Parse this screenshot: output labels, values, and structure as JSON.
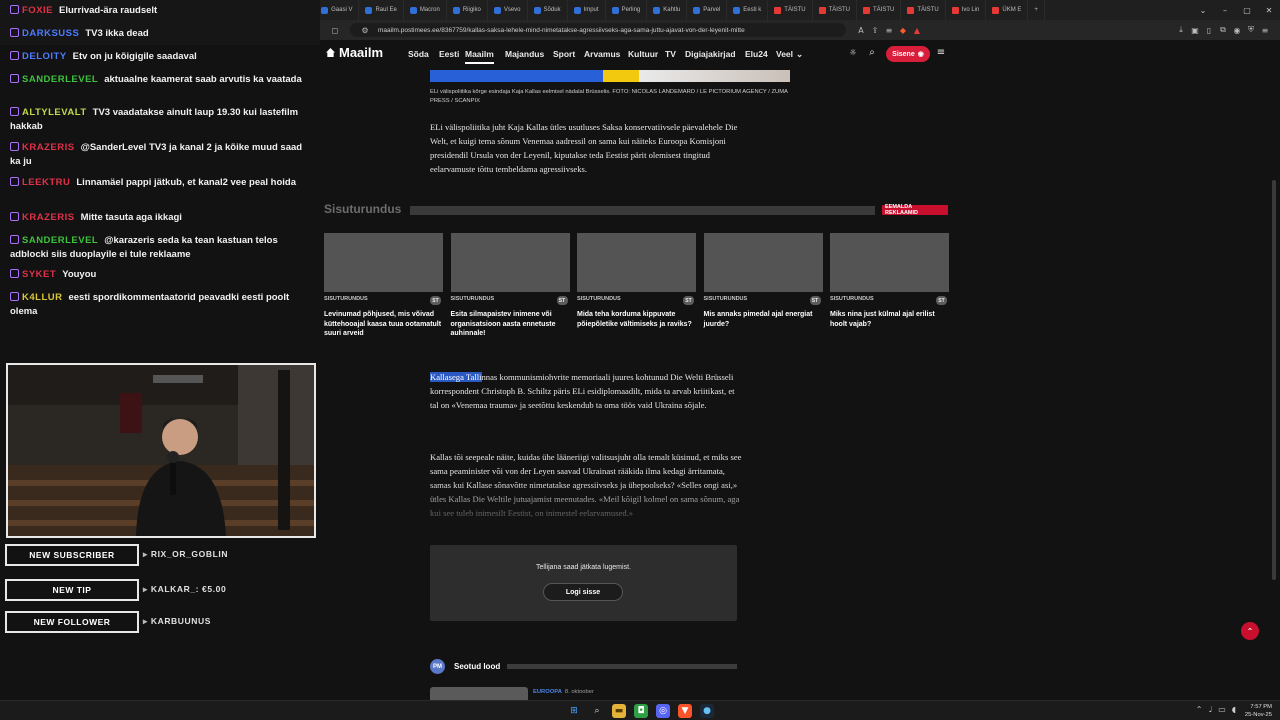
{
  "browser": {
    "tabs": [
      {
        "label": "Kal",
        "type": "normal",
        "active": true
      },
      {
        "label": "FOXIE",
        "type": "yt"
      },
      {
        "label": "Elurrivad-ära raudselt",
        "type": "normal"
      },
      {
        "label": "Sotsiaa",
        "type": "normal"
      },
      {
        "label": "Kohus",
        "type": "normal"
      },
      {
        "label": "Europ",
        "type": "normal"
      },
      {
        "label": "Tallinn",
        "type": "normal"
      },
      {
        "label": "Gaasi V",
        "type": "normal"
      },
      {
        "label": "Raul Ee",
        "type": "normal"
      },
      {
        "label": "Macron",
        "type": "normal"
      },
      {
        "label": "Riigiko",
        "type": "normal"
      },
      {
        "label": "Vsevo",
        "type": "normal"
      },
      {
        "label": "Sõduk",
        "type": "normal"
      },
      {
        "label": "Imput",
        "type": "normal"
      },
      {
        "label": "Perling",
        "type": "normal"
      },
      {
        "label": "Kahtlu",
        "type": "normal"
      },
      {
        "label": "Parvel",
        "type": "normal"
      },
      {
        "label": "Eesti k",
        "type": "normal"
      },
      {
        "label": "TÄISTU",
        "type": "yt"
      },
      {
        "label": "TÄISTU",
        "type": "yt"
      },
      {
        "label": "TÄISTU",
        "type": "yt"
      },
      {
        "label": "TÄISTU",
        "type": "yt"
      },
      {
        "label": "Ivo Lin",
        "type": "yt"
      },
      {
        "label": "ÜKM E",
        "type": "yt"
      }
    ],
    "new_tab": "+",
    "url": "maailm.postimees.ee/8367759/kallas-saksa-lehele-mind-nimetatakse-agressiivseks-aga-sama-juttu-ajavat-von-der-leyenit-mitte"
  },
  "chat": {
    "top_partial": {
      "user": "FOXIE",
      "text": "Elurrivad-ära raudselt"
    },
    "messages": [
      {
        "user": "DARKSUSS",
        "color": "#4c7cff",
        "text": "TV3 ikka dead"
      },
      {
        "user": "DELOITY",
        "color": "#4c7cff",
        "text": "Etv on ju kõigigile saadaval"
      },
      {
        "user": "SANDERLEVEL",
        "color": "#3ec23e",
        "text": "aktuaalne kaamerat saab arvutis ka vaatada"
      },
      {
        "user": "ALTYLEVALT",
        "color": "#c4d94a",
        "text": "TV3 vaadatakse ainult laup 19.30 kui lastefilm hakkab"
      },
      {
        "user": "KRAZERIS",
        "color": "#e0314a",
        "text": "@SanderLevel TV3 ja kanal 2 ja kõike muud saad ka ju"
      },
      {
        "user": "LEEKTRU",
        "color": "#e0314a",
        "text": "Linnamäel pappi jätkub, et kanal2 vee peal hoida"
      },
      {
        "user": "KRAZERIS",
        "color": "#e0314a",
        "text": "Mitte tasuta aga ikkagi"
      },
      {
        "user": "SANDERLEVEL",
        "color": "#3ec23e",
        "text": "@karazeris seda ka tean kastuan telos adblocki siis duoplayile ei tule reklaame"
      },
      {
        "user": "SYKET",
        "color": "#e0314a",
        "text": "Youyou"
      },
      {
        "user": "K4LLUR",
        "color": "#d9c63a",
        "text": "eesti spordikommentaatorid peavadki eesti poolt olema"
      }
    ]
  },
  "alerts": [
    {
      "label": "NEW SUBSCRIBER",
      "value": "RIX_OR_GOBLIN"
    },
    {
      "label": "NEW TIP",
      "value": "KALKAR_: €5.00"
    },
    {
      "label": "NEW FOLLOWER",
      "value": "KARBUUNUS"
    }
  ],
  "site": {
    "logo": "Maailm",
    "nav": [
      "Sõda",
      "Eesti",
      "Maailm",
      "Majandus",
      "Sport",
      "Arvamus",
      "Kultuur",
      "TV",
      "Digiajakirjad",
      "Elu24",
      "Veel"
    ],
    "active_nav": "Maailm",
    "login_label": "Sisene"
  },
  "article": {
    "caption": "ELi välispoliitika kõrge esindaja Kaja Kallas eelmisel nädalal Brüsselis. FOTO: NICOLAS LANDEMARD / LE PICTORIUM AGENCY / ZUMA PRESS / SCANPIX",
    "para1": "ELi välispoliitika juht Kaja Kallas ütles usutluses Saksa konservatiivsele päevalehele Die Welt, et kuigi tema sõnum Venemaa aadressil on sama kui näiteks Euroopa Komisjoni presidendil Ursula von der Leyenil, kiputakse teda Eestist pärit olemisest tingitud eelarvamuste tõttu tembeldama agressiivseks.",
    "para2_highlight": "Kallasega Talli",
    "para2_rest": "nnas kommunismiohvrite memoriaali juures kohtunud Die Welti Brüsseli korrespondent Christoph B. Schiltz päris ELi esidiplomaadilt, mida ta arvab kriitikast, et tal on «Venemaa trauma» ja seetõttu keskendub ta oma töös vaid Ukraina sõjale.",
    "para3": "Kallas tõi seepeale näite, kuidas ühe lääneriigi valitsusjuht olla temalt küsinud, et miks see sama peaminister või von der Leyen saavad Ukrainast rääkida ilma kedagi ärritamata, samas kui Kallase sõnavõtte nimetatakse agressiivseks ja ühepoolseks? «Selles ongi asi,» ütles Kallas Die Weltile jutuajamist meenutades. «Meil kõigil kolmel on sama sõnum, aga kui see tuleb inimesilt Eestist, on inimestel eelarvamused.»"
  },
  "sisuturundus": {
    "title": "Sisuturundus",
    "remove_ads": "EEMALDA REKLAAMID",
    "cards": [
      {
        "category": "SISUTURUNDUS",
        "badge": "ST",
        "title": "Levinumad põhjused, mis võivad küttehooajal kaasa tuua ootamatult suuri arveid"
      },
      {
        "category": "SISUTURUNDUS",
        "badge": "ST",
        "title": "Esita silmapaistev inimene või organisatsioon aasta ennetuste auhinnale!"
      },
      {
        "category": "SISUTURUNDUS",
        "badge": "ST",
        "title": "Mida teha korduma kippuvate põiepõletike vältimiseks ja raviks?"
      },
      {
        "category": "SISUTURUNDUS",
        "badge": "ST",
        "title": "Mis annaks pimedal ajal energiat juurde?"
      },
      {
        "category": "SISUTURUNDUS",
        "badge": "ST",
        "title": "Miks nina just külmal ajal erilist hoolt vajab?"
      }
    ]
  },
  "paywall": {
    "text": "Tellijana saad jätkata lugemist.",
    "button": "Logi sisse"
  },
  "related": {
    "logo": "PM",
    "title": "Seotud lood",
    "next_category": "EUROOPA",
    "next_date": "8. oktoober"
  },
  "taskbar": {
    "time": "7:57 PM",
    "date": "25-Nov-25"
  },
  "colors": {
    "accent_red": "#c8102e",
    "twitch_purple": "#a970ff",
    "highlight_blue": "#2b59c3"
  }
}
